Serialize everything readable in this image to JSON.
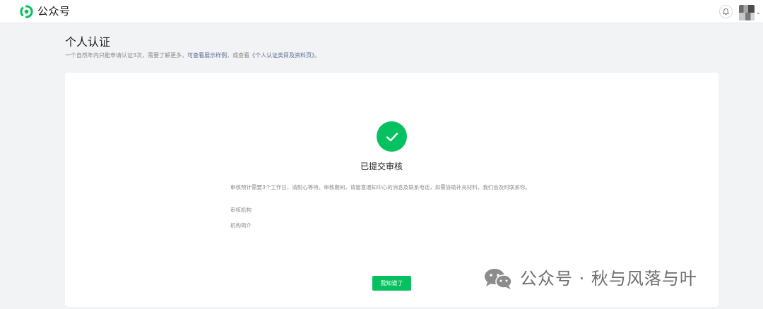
{
  "topbar": {
    "brand": "公众号",
    "logo_icon": "wechat-official-accounts-logo",
    "bell_icon": "bell-icon",
    "avatar_caret": "⌄"
  },
  "header": {
    "title": "个人认证",
    "desc_prefix": "一个自然年内只能申请认证3次，需要了解更多，",
    "desc_link1": "可查看展示样例",
    "desc_mid": "，或查看",
    "desc_link2": "《个人认证类目及资料页》",
    "desc_suffix": "。"
  },
  "result": {
    "status_title": "已提交审核",
    "status_desc": "审核预计需要3个工作日，请耐心等待。审核期间，请留意通知中心的消息及联系电话，如需协助补充材料，我们会及时联系你。",
    "field_org_label": "审核机构",
    "field_intro_label": "机构简介",
    "confirm_label": "我知道了"
  },
  "watermark": {
    "text": "公众号 · 秋与风落与叶"
  },
  "colors": {
    "accent": "#07c160",
    "link": "#576b95",
    "page_bg": "#f2f3f5"
  }
}
